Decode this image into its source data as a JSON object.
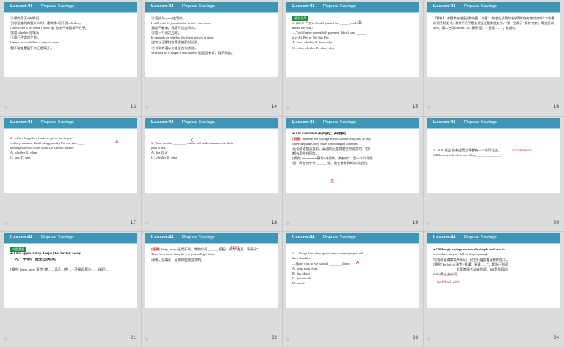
{
  "header": {
    "lesson": "Lesson 44",
    "topic": "Popular Sayings"
  },
  "slides": [
    {
      "num": "13",
      "lines": [
        "②通常用于if的情况",
        "引导否定的宾语从句时，通常用if而不用whether。",
        "I don't care if he doesn't show up. 他来不来我都不在乎。",
        "⑶用 whether 的情况",
        "①用于不定式之前。",
        "I'm not sure whether to stay or leave.",
        "我不确定是留下来还是离开。"
      ]
    },
    {
      "num": "14",
      "lines": [
        "②直接与or not连用时。",
        "I will write to you whether or not I can come.",
        "我能不能来，我将写信告诉你。",
        "③用于介词之后时。",
        "It depends on whether the letter arrives in time.",
        "这取决于那封信是否能及时送到。",
        "④引导宾语从句且放在句首时。",
        "Whether he is single, I don't know. 他是否单身，我不知道。"
      ]
    },
    {
      "num": "15",
      "tag": "易学活用",
      "lines": [
        "1. (2018·广东)—Could you tell me _____ you'd like",
        "me to pay you?",
        "—You'd better use mobile payment. I don't care ______",
        "it is Ali Pay or WeChat Pay.",
        "A. how; whether      B. how; why",
        "C. what; whether     D. what; why"
      ],
      "answer": "A"
    },
    {
      "num": "16",
      "lines": [
        "【解析】 本题考查连接词和句意。句意：“你能告诉我你希望我如何给你付款吗？”“你最好用手机支付。我并不在乎是支付宝还是微信支付。”第一空表示“如何”付款，用连接词how；第二空用whether...or...表示“是……还是……”。故选A。"
      ]
    },
    {
      "num": "17",
      "lines": [
        "2. —How long does it take to get to the airport?",
        "—Forty minutes. But it's foggy today. I'm not sure ____",
        "the highway will close soon. Let's set off earlier.",
        "A. whether     B. when",
        "C. how         D. why"
      ],
      "answer": "A"
    },
    {
      "num": "18",
      "lines": [
        "3. They wonder ________ robots will make humans lose their",
        "jobs or not.",
        "A. that       B. if",
        "C. whether    D. what"
      ],
      "answer": "C"
    },
    {
      "num": "19",
      "heading": "●2  in common 共同的；共有的",
      "tag": "[观察]",
      "lines": [
        "Whether the sayings are in Chinese, English, or any",
        "other language, they share something in common.",
        "无论谚语是汉语的、英语的还是其他任何语言的，它们",
        "都有某些共同点。",
        "[探究] in common意为“共同的，共有的”，是一个介词短",
        "语，常在句中作 ______ 语，放在被修饰的名词之后。"
      ],
      "answer": "定"
    },
    {
      "num": "20",
      "lines": [
        "2. 2018·眉山  所有这篇文章都有一个共同之处。",
        "All these articles have one thing _______________."
      ],
      "answer": "in common"
    },
    {
      "num": "21",
      "tag": "句型透视",
      "heading": "●1  An apple a day keeps the doctor away.",
      "lines": [
        "一天一苹果，医生远离我。",
        "[探究] keep...away 意为“使……离开，使……不接近/阻止……接近”。"
      ]
    },
    {
      "num": "22",
      "tag": "[拓展]",
      "lines": [
        "keep...away 还用于时，常和介词 ______ 搭配，意为“避开，不接近”。",
        "Tom, keep away from fire, or you will get burnt.",
        "汤姆，远离火，否则你会被烧伤的。"
      ],
      "answer": "from"
    },
    {
      "num": "23",
      "lines": [
        "1. —Drugs have done great harm to some people and",
        "their families.",
        "—Quite true, so we should ________ them.",
        "A. keep away from",
        "B. shut down",
        "C. get on with",
        "D. put off"
      ],
      "answer": "A"
    },
    {
      "num": "24",
      "heading": "●2  Although sayings are usually simple and easy to",
      "lines": [
        "remember, they are full of deep meaning.",
        "尽管谚语通常简单易记，但它们蕴含着深刻的含义。",
        "[探究] be full of 意为“充满；装满……”，相当于短语",
        "____________，后面常接名词或代词。full是形容词，",
        "filled是过去分词。"
      ],
      "answer": "be filled with"
    }
  ],
  "footer": {
    "star": "☆"
  }
}
